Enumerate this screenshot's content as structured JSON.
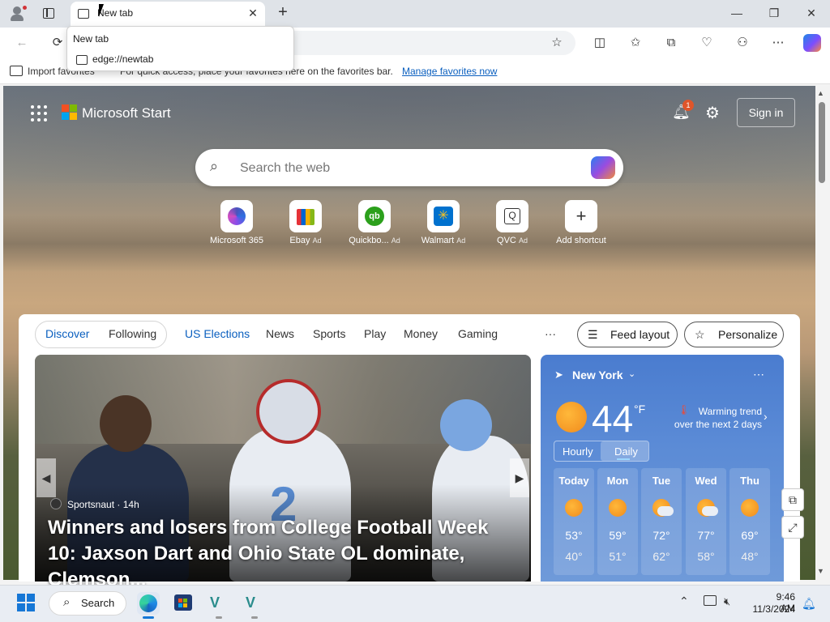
{
  "browser": {
    "tab_title": "New tab",
    "tooltip": {
      "title": "New tab",
      "url": "edge://newtab"
    },
    "favorites_bar": {
      "import_label": "Import favorites",
      "tip_text": "For quick access, place your favorites here on the favorites bar.",
      "manage_link": "Manage favorites now"
    }
  },
  "start_page": {
    "brand": "Microsoft Start",
    "notification_count": "1",
    "sign_in": "Sign in",
    "search_placeholder": "Search the web",
    "shortcuts": [
      {
        "label": "Microsoft 365",
        "ad": ""
      },
      {
        "label": "Ebay",
        "ad": "Ad"
      },
      {
        "label": "Quickbo...",
        "ad": "Ad"
      },
      {
        "label": "Walmart",
        "ad": "Ad"
      },
      {
        "label": "QVC",
        "ad": "Ad"
      },
      {
        "label": "Add shortcut",
        "ad": ""
      }
    ]
  },
  "feed": {
    "pill_tabs": [
      "Discover",
      "Following"
    ],
    "tabs": [
      "US Elections",
      "News",
      "Sports",
      "Play",
      "Money",
      "Gaming"
    ],
    "more": "···",
    "feed_layout": "Feed layout",
    "personalize": "Personalize"
  },
  "hero": {
    "source": "Sportsnaut",
    "age": "14h",
    "title": "Winners and losers from College Football Week 10: Jaxson Dart and Ohio State OL dominate, Clemson..."
  },
  "weather": {
    "city": "New York",
    "temp": "44",
    "unit": "°F",
    "trend_title": "Warming trend",
    "trend_sub": "over the next 2 days",
    "tab_hourly": "Hourly",
    "tab_daily": "Daily",
    "days": [
      {
        "name": "Today",
        "hi": "53°",
        "lo": "40°",
        "icon": "sun-icon"
      },
      {
        "name": "Mon",
        "hi": "59°",
        "lo": "51°",
        "icon": "sun-icon"
      },
      {
        "name": "Tue",
        "hi": "72°",
        "lo": "62°",
        "icon": "partly-cloudy-icon"
      },
      {
        "name": "Wed",
        "hi": "77°",
        "lo": "58°",
        "icon": "partly-cloudy-icon"
      },
      {
        "name": "Thu",
        "hi": "69°",
        "lo": "48°",
        "icon": "sun-icon"
      }
    ]
  },
  "taskbar": {
    "search_label": "Search",
    "time": "9:46 AM",
    "date": "11/3/2024"
  },
  "colors": {
    "accent": "#0a5fbf",
    "notification": "#e0552a"
  }
}
